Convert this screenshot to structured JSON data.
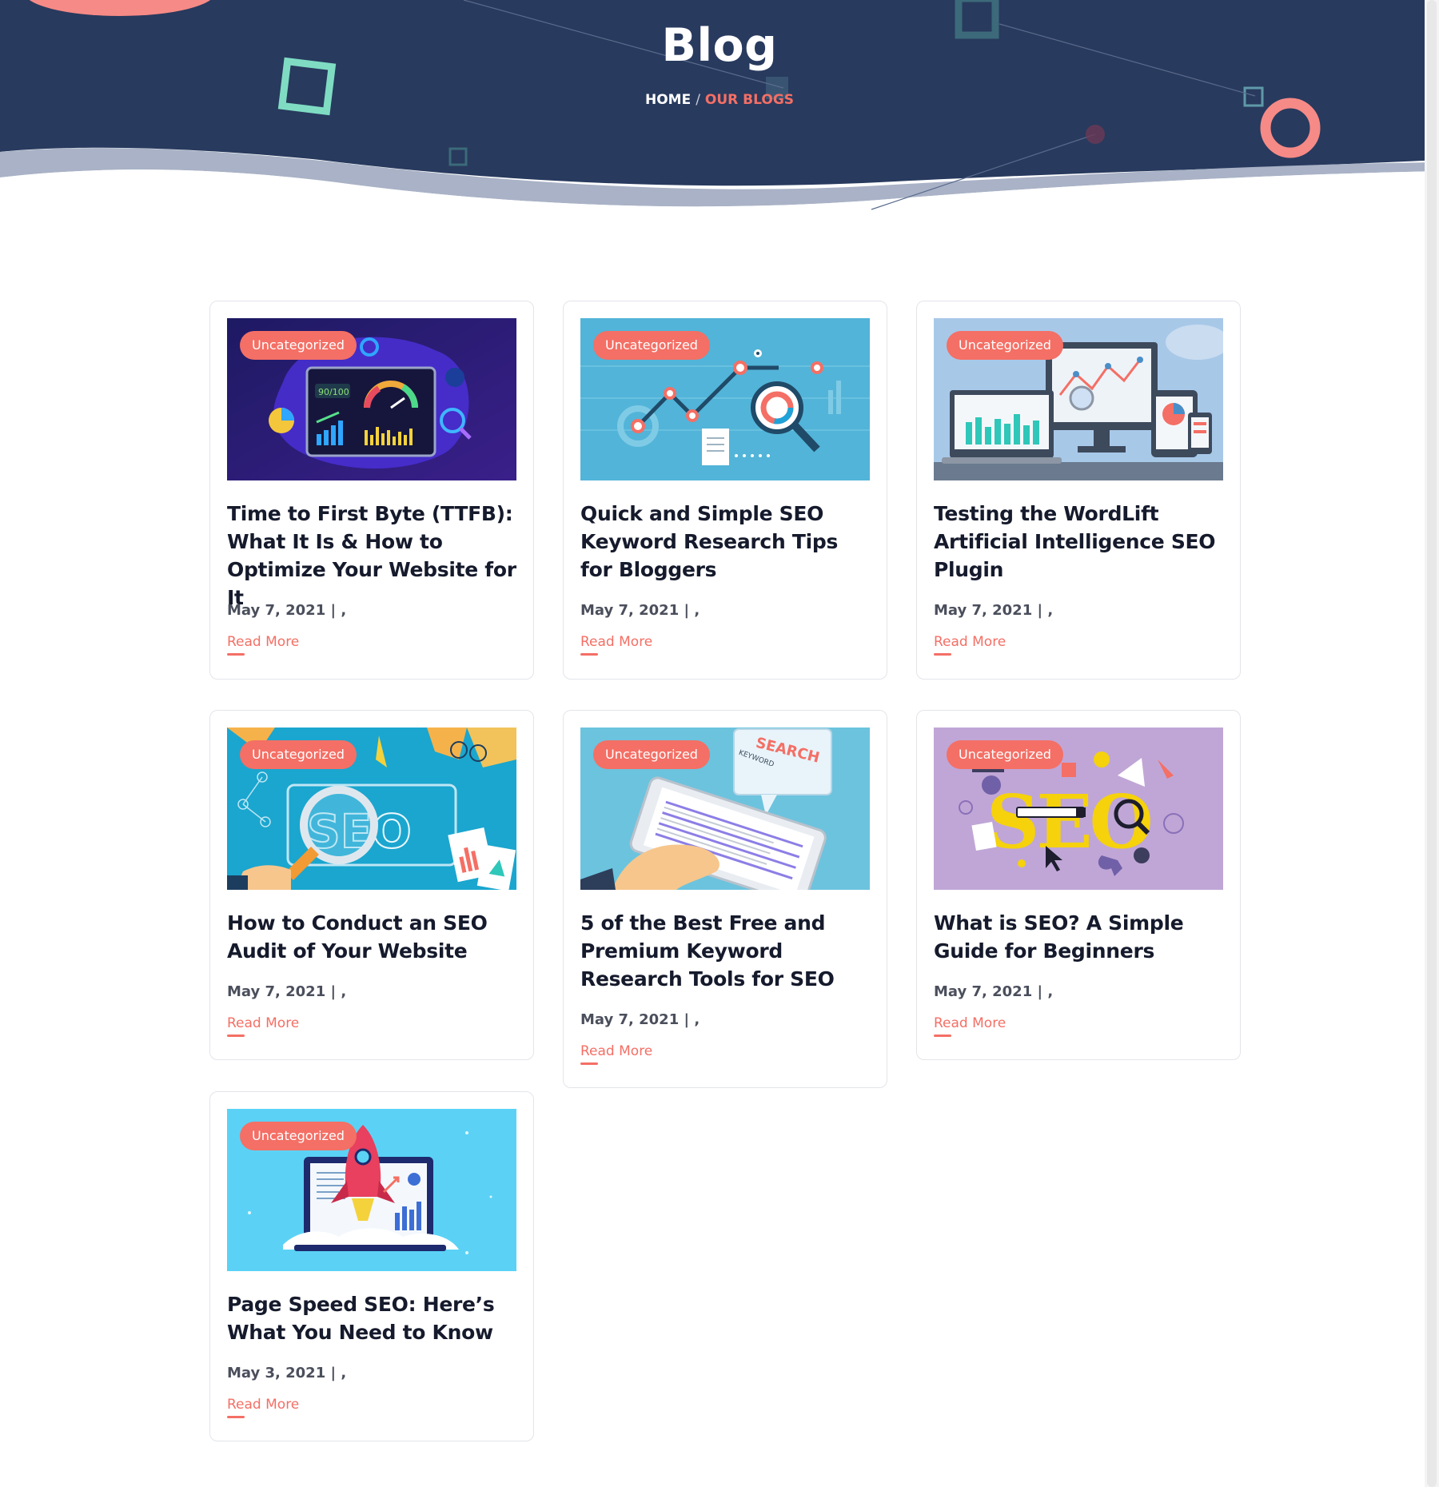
{
  "hero": {
    "title": "Blog",
    "breadcrumb": {
      "home": "HOME",
      "separator": "/",
      "current": "OUR BLOGS"
    }
  },
  "colors": {
    "navy": "#283a5e",
    "accent": "#f46f65",
    "mint": "#7fdcc3"
  },
  "posts": [
    {
      "category": "Uncategorized",
      "title": "Time to First Byte (TTFB): What It Is & How to Optimize Your Website for It",
      "date": "May 7, 2021 | ,",
      "read_more": "Read More",
      "image": "speed-dashboard-illustration"
    },
    {
      "category": "Uncategorized",
      "title": "Quick and Simple SEO Keyword Research Tips for Bloggers",
      "date": "May 7, 2021 | ,",
      "read_more": "Read More",
      "image": "keyword-graph-illustration"
    },
    {
      "category": "Uncategorized",
      "title": "Testing the WordLift Artificial Intelligence SEO Plugin",
      "date": "May 7, 2021 | ,",
      "read_more": "Read More",
      "image": "devices-analytics-illustration"
    },
    {
      "category": "Uncategorized",
      "title": "How to Conduct an SEO Audit of Your Website",
      "date": "May 7, 2021 | ,",
      "read_more": "Read More",
      "image": "seo-magnifier-illustration"
    },
    {
      "category": "Uncategorized",
      "title": "5 of the Best Free and Premium Keyword Research Tools for SEO",
      "date": "May 7, 2021 | ,",
      "read_more": "Read More",
      "image": "tablet-search-illustration"
    },
    {
      "category": "Uncategorized",
      "title": "What is SEO? A Simple Guide for Beginners",
      "date": "May 7, 2021 | ,",
      "read_more": "Read More",
      "image": "seo-letters-illustration"
    },
    {
      "category": "Uncategorized",
      "title": "Page Speed SEO: Here’s What You Need to Know",
      "date": "May 3, 2021 | ,",
      "read_more": "Read More",
      "image": "rocket-laptop-illustration"
    }
  ]
}
